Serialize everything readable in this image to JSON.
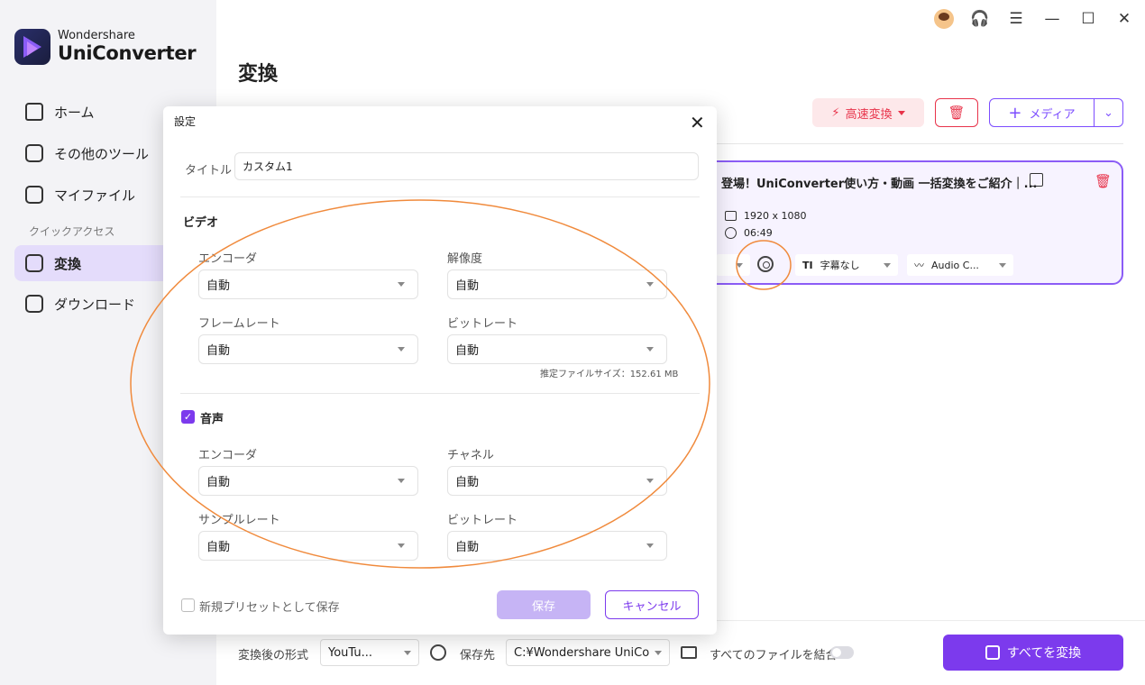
{
  "app": {
    "brand_small": "Wondershare",
    "brand_big": "UniConverter",
    "accent": "#7c3aed",
    "annotation_color": "#f08a3c"
  },
  "sidebar": {
    "items": [
      {
        "label": "ホーム",
        "icon": "home-icon"
      },
      {
        "label": "その他のツール",
        "icon": "toolbox-icon"
      },
      {
        "label": "マイファイル",
        "icon": "file-icon"
      }
    ],
    "section": "クイックアクセス",
    "quick": [
      {
        "label": "変換",
        "icon": "convert-icon",
        "active": true
      },
      {
        "label": "ダウンロード",
        "icon": "download-icon"
      }
    ]
  },
  "main": {
    "title": "変換",
    "fast_convert": "高速変換",
    "add_media": "メディア",
    "card": {
      "title": "登場！UniConverter使い方・動画 一括変換をご紹介｜...",
      "resolution": "1920 x 1080",
      "duration": "06:49",
      "subtitle": "字幕なし",
      "audio": "Audio C..."
    }
  },
  "bottom": {
    "format_label": "変換後の形式",
    "format_value": "YouTu...",
    "save_label": "保存先",
    "save_path": "C:¥Wondershare UniCor",
    "merge_label": "すべてのファイルを結合",
    "convert_all": "すべてを変換"
  },
  "dialog": {
    "title": "設定",
    "title_label": "タイトル",
    "title_value": "カスタム1",
    "video_section": "ビデオ",
    "video": {
      "encoder_label": "エンコーダ",
      "encoder_value": "自動",
      "resolution_label": "解像度",
      "resolution_value": "自動",
      "framerate_label": "フレームレート",
      "framerate_value": "自動",
      "bitrate_label": "ビットレート",
      "bitrate_value": "自動",
      "estimate": "推定ファイルサイズ：152.61 MB"
    },
    "audio_section": "音声",
    "audio_checked": true,
    "audio": {
      "encoder_label": "エンコーダ",
      "encoder_value": "自動",
      "channel_label": "チャネル",
      "channel_value": "自動",
      "samplerate_label": "サンプルレート",
      "samplerate_value": "自動",
      "bitrate_label": "ビットレート",
      "bitrate_value": "自動"
    },
    "preset_label": "新規プリセットとして保存",
    "save_button": "保存",
    "cancel_button": "キャンセル"
  }
}
